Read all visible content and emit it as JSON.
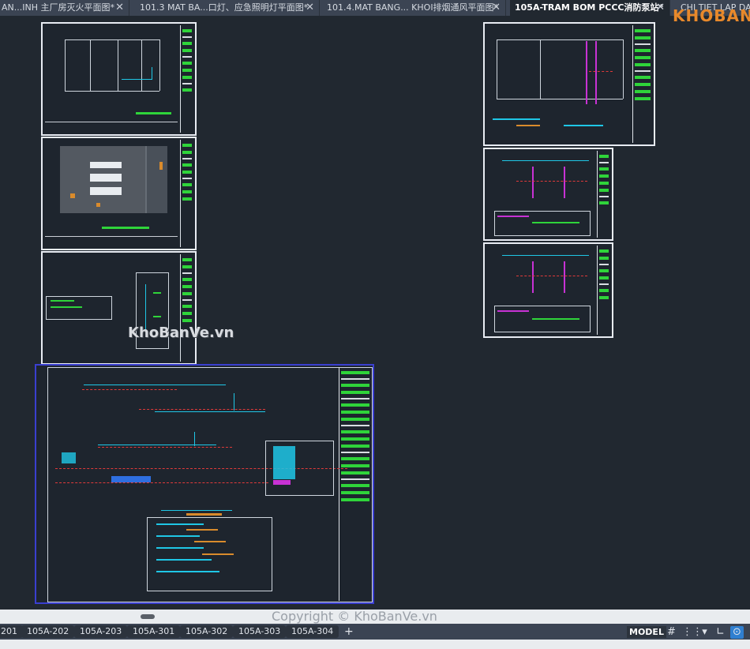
{
  "file_tabs": [
    {
      "label": "AN...INH 主厂房灭火平面图*",
      "active": false
    },
    {
      "label": "101.3 MAT BA...口灯、应急照明灯平面图*",
      "active": false
    },
    {
      "label": "101.4.MAT BANG... KHOI排烟通风平面图*",
      "active": false
    },
    {
      "label": "105A-TRAM BOM PCCC消防泵站*",
      "active": true
    },
    {
      "label": "CHI TIET LAP DAT",
      "active": false
    }
  ],
  "tab_close_glyph": "✕",
  "watermark": "KhoBanVe.vn",
  "logo": "KHOBANVE",
  "copyright": "Copyright © KhoBanVe.vn",
  "layout_tabs": [
    "201",
    "105A-202",
    "105A-203",
    "105A-301",
    "105A-302",
    "105A-303",
    "105A-304"
  ],
  "add_tab_label": "+",
  "status": {
    "model_label": "MODEL",
    "icons": [
      "grid-icon",
      "snap-icon",
      "dropdown-chevron-icon",
      "ortho-icon",
      "polar-tracking-icon"
    ]
  },
  "colors": {
    "canvas_bg": "#212830",
    "sheet_border": "#e8ecf3",
    "highlight_border": "#3a3fd0",
    "cyan": "#1fc7e6",
    "green": "#2fd43a",
    "red": "#e03a3a",
    "magenta": "#c832d4",
    "logo_orange": "#e8892b"
  }
}
